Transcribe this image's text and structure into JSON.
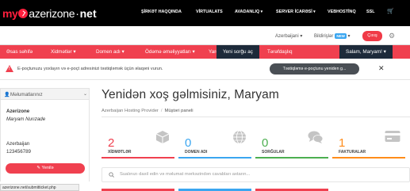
{
  "colors": {
    "accent": "#f0404f",
    "dark_nav": "#1d2a3a",
    "services": "#f0404f",
    "domains": "#3aa6f0",
    "requests": "#4caf50",
    "invoices": "#ff8c1a"
  },
  "logo": {
    "my": "my",
    "name": "azerizone",
    "dot": "·",
    "net": "net"
  },
  "topnav": [
    {
      "label": "ŞİRKƏT HAQQINDA"
    },
    {
      "label": "VİRTUALATS"
    },
    {
      "label": "AVADANLIQ"
    },
    {
      "label": "SERVER İCARƏSİ"
    },
    {
      "label": "VEBHOSTİNQ"
    },
    {
      "label": "SSL"
    },
    {
      "icon": "cart-icon",
      "label": "🛒"
    }
  ],
  "subbar": {
    "language": "Azerbaijani ▾",
    "notifications": "Bildirişlər",
    "new_badge": "NEW",
    "notif_caret": "▾",
    "exit": "Çıxış",
    "gear_icon": "⚙"
  },
  "menubar": {
    "items": [
      {
        "label": "Əsas səhifə"
      },
      {
        "label": "Xidmətlər ▾"
      },
      {
        "label": "Domen adı ▾"
      },
      {
        "label": "Ödəmə əməliyyatları ▾"
      },
      {
        "label": "Yardım ▾"
      },
      {
        "label": "Yeni sorğu aç"
      },
      {
        "label": "Tərəfdaşlıq"
      }
    ],
    "greeting": "Salam, Maryam! ▾"
  },
  "alert": {
    "text": "E-poçtunuzu yoxlayın və e-poçt adresinizi təstiqləmək üçün əlaqəni vurun.",
    "button": "Təstiqləmə e-poçtunu yeniden g...",
    "close": "✕"
  },
  "sidebar": {
    "title": "Məlumatlarınız",
    "user_icon": "👤",
    "chevron": "⌄",
    "company": "Azerizone",
    "name": "Maryam Nurızade",
    "country": "Azerbaijan",
    "phone": "123456789",
    "update_button": "✎ Yenilə"
  },
  "main": {
    "welcome": "Yenidən xoş gəlmisiniz, Maryam",
    "breadcrumbs": [
      "Azerbaijan Hosting Provider",
      "Müştəri paneli"
    ],
    "tiles": [
      {
        "value": "2",
        "label": "XİDMƏTLƏR",
        "icon": "box-icon"
      },
      {
        "value": "0",
        "label": "DOMEN ADI",
        "icon": "globe-icon"
      },
      {
        "value": "0",
        "label": "SORĞULAR",
        "icon": "comments-icon"
      },
      {
        "value": "1",
        "label": "FAKTURALAR",
        "icon": "credit-card-icon"
      }
    ],
    "search_placeholder": "Sualınızı daxil edin və məlumat mərkəzindən cavabları axtarın..."
  },
  "status_url": "azerizone.net/submitticket.php"
}
